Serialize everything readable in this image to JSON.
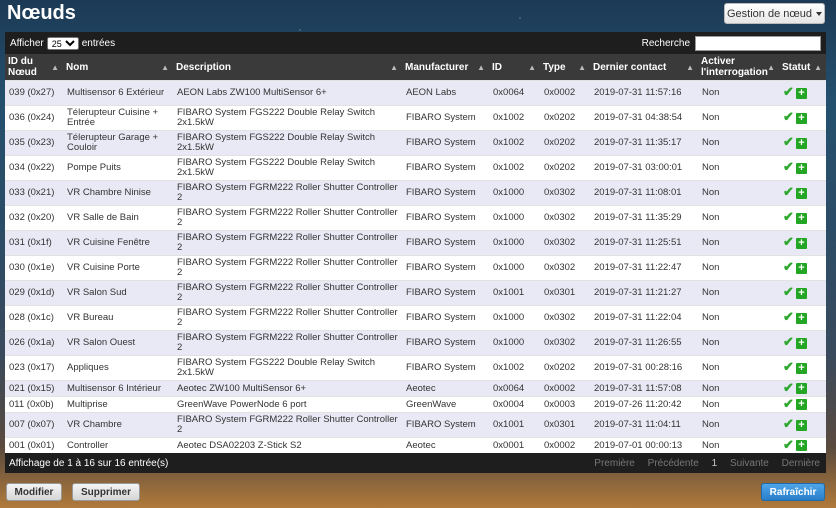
{
  "page": {
    "title": "Nœuds",
    "management_button": "Gestion de nœud"
  },
  "controls": {
    "show_label": "Afficher",
    "page_size": "25",
    "entries_label": "entrées",
    "search_label": "Recherche",
    "search_value": ""
  },
  "columns": [
    "ID du Nœud",
    "Nom",
    "Description",
    "Manufacturer",
    "ID",
    "Type",
    "Dernier contact",
    "Activer l'interrogation",
    "Statut"
  ],
  "rows": [
    [
      "039 (0x27)",
      "Multisensor 6 Extérieur",
      "AEON Labs ZW100 MultiSensor 6+",
      "AEON Labs",
      "0x0064",
      "0x0002",
      "2019-07-31 11:57:16",
      "Non"
    ],
    [
      "036 (0x24)",
      "Télerupteur Cuisine + Entrée",
      "FIBARO System FGS222 Double Relay Switch 2x1.5kW",
      "FIBARO System",
      "0x1002",
      "0x0202",
      "2019-07-31 04:38:54",
      "Non"
    ],
    [
      "035 (0x23)",
      "Télerupteur Garage + Couloir",
      "FIBARO System FGS222 Double Relay Switch 2x1.5kW",
      "FIBARO System",
      "0x1002",
      "0x0202",
      "2019-07-31 11:35:17",
      "Non"
    ],
    [
      "034 (0x22)",
      "Pompe Puits",
      "FIBARO System FGS222 Double Relay Switch 2x1.5kW",
      "FIBARO System",
      "0x1002",
      "0x0202",
      "2019-07-31 03:00:01",
      "Non"
    ],
    [
      "033 (0x21)",
      "VR Chambre Ninise",
      "FIBARO System FGRM222 Roller Shutter Controller 2",
      "FIBARO System",
      "0x1000",
      "0x0302",
      "2019-07-31 11:08:01",
      "Non"
    ],
    [
      "032 (0x20)",
      "VR Salle de Bain",
      "FIBARO System FGRM222 Roller Shutter Controller 2",
      "FIBARO System",
      "0x1000",
      "0x0302",
      "2019-07-31 11:35:29",
      "Non"
    ],
    [
      "031 (0x1f)",
      "VR Cuisine Fenêtre",
      "FIBARO System FGRM222 Roller Shutter Controller 2",
      "FIBARO System",
      "0x1000",
      "0x0302",
      "2019-07-31 11:25:51",
      "Non"
    ],
    [
      "030 (0x1e)",
      "VR Cuisine Porte",
      "FIBARO System FGRM222 Roller Shutter Controller 2",
      "FIBARO System",
      "0x1000",
      "0x0302",
      "2019-07-31 11:22:47",
      "Non"
    ],
    [
      "029 (0x1d)",
      "VR Salon Sud",
      "FIBARO System FGRM222 Roller Shutter Controller 2",
      "FIBARO System",
      "0x1001",
      "0x0301",
      "2019-07-31 11:21:27",
      "Non"
    ],
    [
      "028 (0x1c)",
      "VR Bureau",
      "FIBARO System FGRM222 Roller Shutter Controller 2",
      "FIBARO System",
      "0x1000",
      "0x0302",
      "2019-07-31 11:22:04",
      "Non"
    ],
    [
      "026 (0x1a)",
      "VR Salon Ouest",
      "FIBARO System FGRM222 Roller Shutter Controller 2",
      "FIBARO System",
      "0x1000",
      "0x0302",
      "2019-07-31 11:26:55",
      "Non"
    ],
    [
      "023 (0x17)",
      "Appliques",
      "FIBARO System FGS222 Double Relay Switch 2x1.5kW",
      "FIBARO System",
      "0x1002",
      "0x0202",
      "2019-07-31 00:28:16",
      "Non"
    ],
    [
      "021 (0x15)",
      "Multisensor 6 Intérieur",
      "Aeotec ZW100 MultiSensor 6+",
      "Aeotec",
      "0x0064",
      "0x0002",
      "2019-07-31 11:57:08",
      "Non"
    ],
    [
      "011 (0x0b)",
      "Multiprise",
      "GreenWave PowerNode 6 port",
      "GreenWave",
      "0x0004",
      "0x0003",
      "2019-07-26 11:20:42",
      "Non"
    ],
    [
      "007 (0x07)",
      "VR Chambre",
      "FIBARO System FGRM222 Roller Shutter Controller 2",
      "FIBARO System",
      "0x1001",
      "0x0301",
      "2019-07-31 11:04:11",
      "Non"
    ],
    [
      "001 (0x01)",
      "Controller",
      "Aeotec DSA02203 Z-Stick S2",
      "Aeotec",
      "0x0001",
      "0x0002",
      "2019-07-01 00:00:13",
      "Non"
    ]
  ],
  "row_heights": [
    "r1",
    "r1",
    "r1",
    "r1",
    "r1",
    "r1",
    "r1",
    "r1",
    "r1",
    "r1",
    "r1",
    "r1",
    "r2",
    "r2",
    "r1",
    "r2"
  ],
  "footer": {
    "info": "Affichage de 1 à 16 sur 16 entrée(s)",
    "first": "Première",
    "prev": "Précédente",
    "current": "1",
    "next": "Suivante",
    "last": "Dernière"
  },
  "buttons": {
    "modify": "Modifier",
    "delete": "Supprimer",
    "refresh": "Rafraîchir"
  },
  "status_icons": [
    "check-icon",
    "plus-icon"
  ]
}
